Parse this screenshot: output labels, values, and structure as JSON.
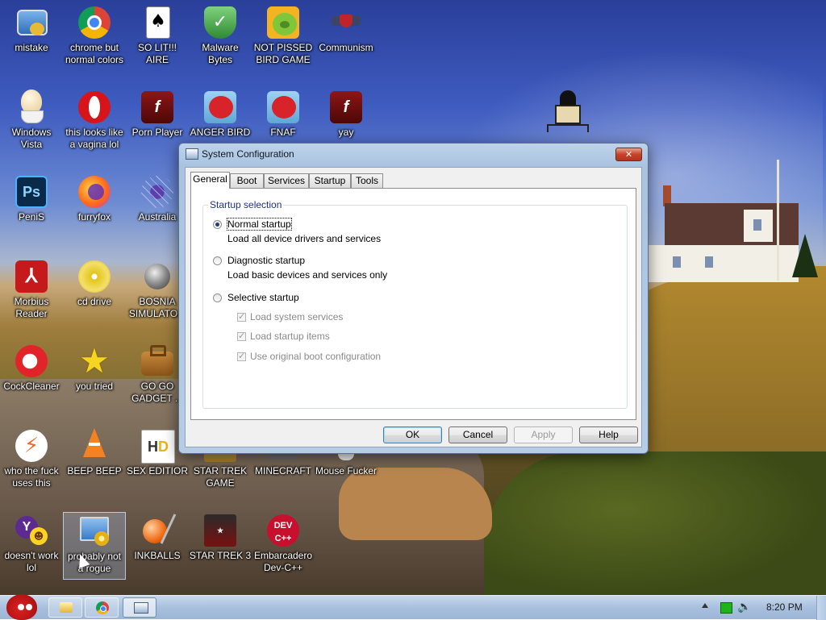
{
  "desktop": {
    "icons": [
      {
        "label": "mistake",
        "icon": "computer-monitor-icon"
      },
      {
        "label": "chrome but\nnormal colors",
        "icon": "chrome-icon"
      },
      {
        "label": "SO LIT!!! AIRE",
        "icon": "solitaire-cards-icon"
      },
      {
        "label": "Malware\nBytes",
        "icon": "shield-check-icon"
      },
      {
        "label": "NOT PISSED\nBIRD GAME",
        "icon": "green-pig-icon"
      },
      {
        "label": "Communism",
        "icon": "red-emblem-icon"
      },
      {
        "label": "Windows\nVista",
        "icon": "egg-cup-icon"
      },
      {
        "label": "this looks like\na vagina lol",
        "icon": "opera-icon"
      },
      {
        "label": "Porn Player",
        "icon": "flash-player-icon"
      },
      {
        "label": "ANGER BIRD",
        "icon": "angry-bird-icon"
      },
      {
        "label": "FNAF",
        "icon": "angry-bird-icon"
      },
      {
        "label": "yay",
        "icon": "flash-player-icon"
      },
      {
        "label": "PeniS",
        "icon": "photoshop-icon"
      },
      {
        "label": "furryfox",
        "icon": "firefox-icon"
      },
      {
        "label": "Australia",
        "icon": "spider-solitaire-icon"
      },
      {
        "label": "Morbius\nReader",
        "icon": "acrobat-reader-icon"
      },
      {
        "label": "cd drive",
        "icon": "cd-disc-icon"
      },
      {
        "label": "BOSNIA\nSIMULATO...",
        "icon": "minesweeper-mine-icon"
      },
      {
        "label": "CockCleaner",
        "icon": "ccleaner-icon"
      },
      {
        "label": "you tried",
        "icon": "gold-star-icon"
      },
      {
        "label": "GO GO\nGADGET ...",
        "icon": "briefcase-icon"
      },
      {
        "label": "who the fuck\nuses this",
        "icon": "lightning-bolt-icon"
      },
      {
        "label": "BEEP BEEP",
        "icon": "vlc-cone-icon"
      },
      {
        "label": "SEX EDITIOR",
        "icon": "hxd-editor-icon"
      },
      {
        "label": "STAR TREK\nGAME",
        "icon": "star-wars-icon"
      },
      {
        "label": "MINECRAFT",
        "icon": "minecraft-icon"
      },
      {
        "label": "Mouse Fucker",
        "icon": "mouse-icon"
      },
      {
        "label": "doesn't work\nlol",
        "icon": "yahoo-messenger-icon"
      },
      {
        "label": "probably not\na rogue",
        "icon": "control-panel-icon"
      },
      {
        "label": "INKBALLS",
        "icon": "inkball-icon"
      },
      {
        "label": "STAR TREK 3",
        "icon": "star-wars-game-icon"
      },
      {
        "label": "Embarcadero\nDev-C++",
        "icon": "devcpp-icon"
      }
    ]
  },
  "dialog": {
    "title": "System Configuration",
    "close_glyph": "✕",
    "tabs": [
      "General",
      "Boot",
      "Services",
      "Startup",
      "Tools"
    ],
    "active_tab": "General",
    "group_label": "Startup selection",
    "options": [
      {
        "label": "Normal startup",
        "desc": "Load all device drivers and services",
        "selected": true
      },
      {
        "label": "Diagnostic startup",
        "desc": "Load basic devices and services only",
        "selected": false
      },
      {
        "label": "Selective startup",
        "desc": "",
        "selected": false
      }
    ],
    "checkboxes": [
      {
        "label": "Load system services",
        "checked": true,
        "disabled": true
      },
      {
        "label": "Load startup items",
        "checked": true,
        "disabled": true
      },
      {
        "label": "Use original boot configuration",
        "checked": true,
        "disabled": true
      }
    ],
    "buttons": {
      "ok": "OK",
      "cancel": "Cancel",
      "apply": "Apply",
      "help": "Help"
    }
  },
  "taskbar": {
    "start_icon": "angry-bird-start-icon",
    "pinned": [
      "windows-explorer-icon",
      "chrome-icon",
      "system-configuration-icon"
    ],
    "tray_icons": [
      "show-hidden-icons-arrow-icon",
      "network-icon",
      "volume-icon"
    ],
    "clock": "8:20 PM"
  }
}
